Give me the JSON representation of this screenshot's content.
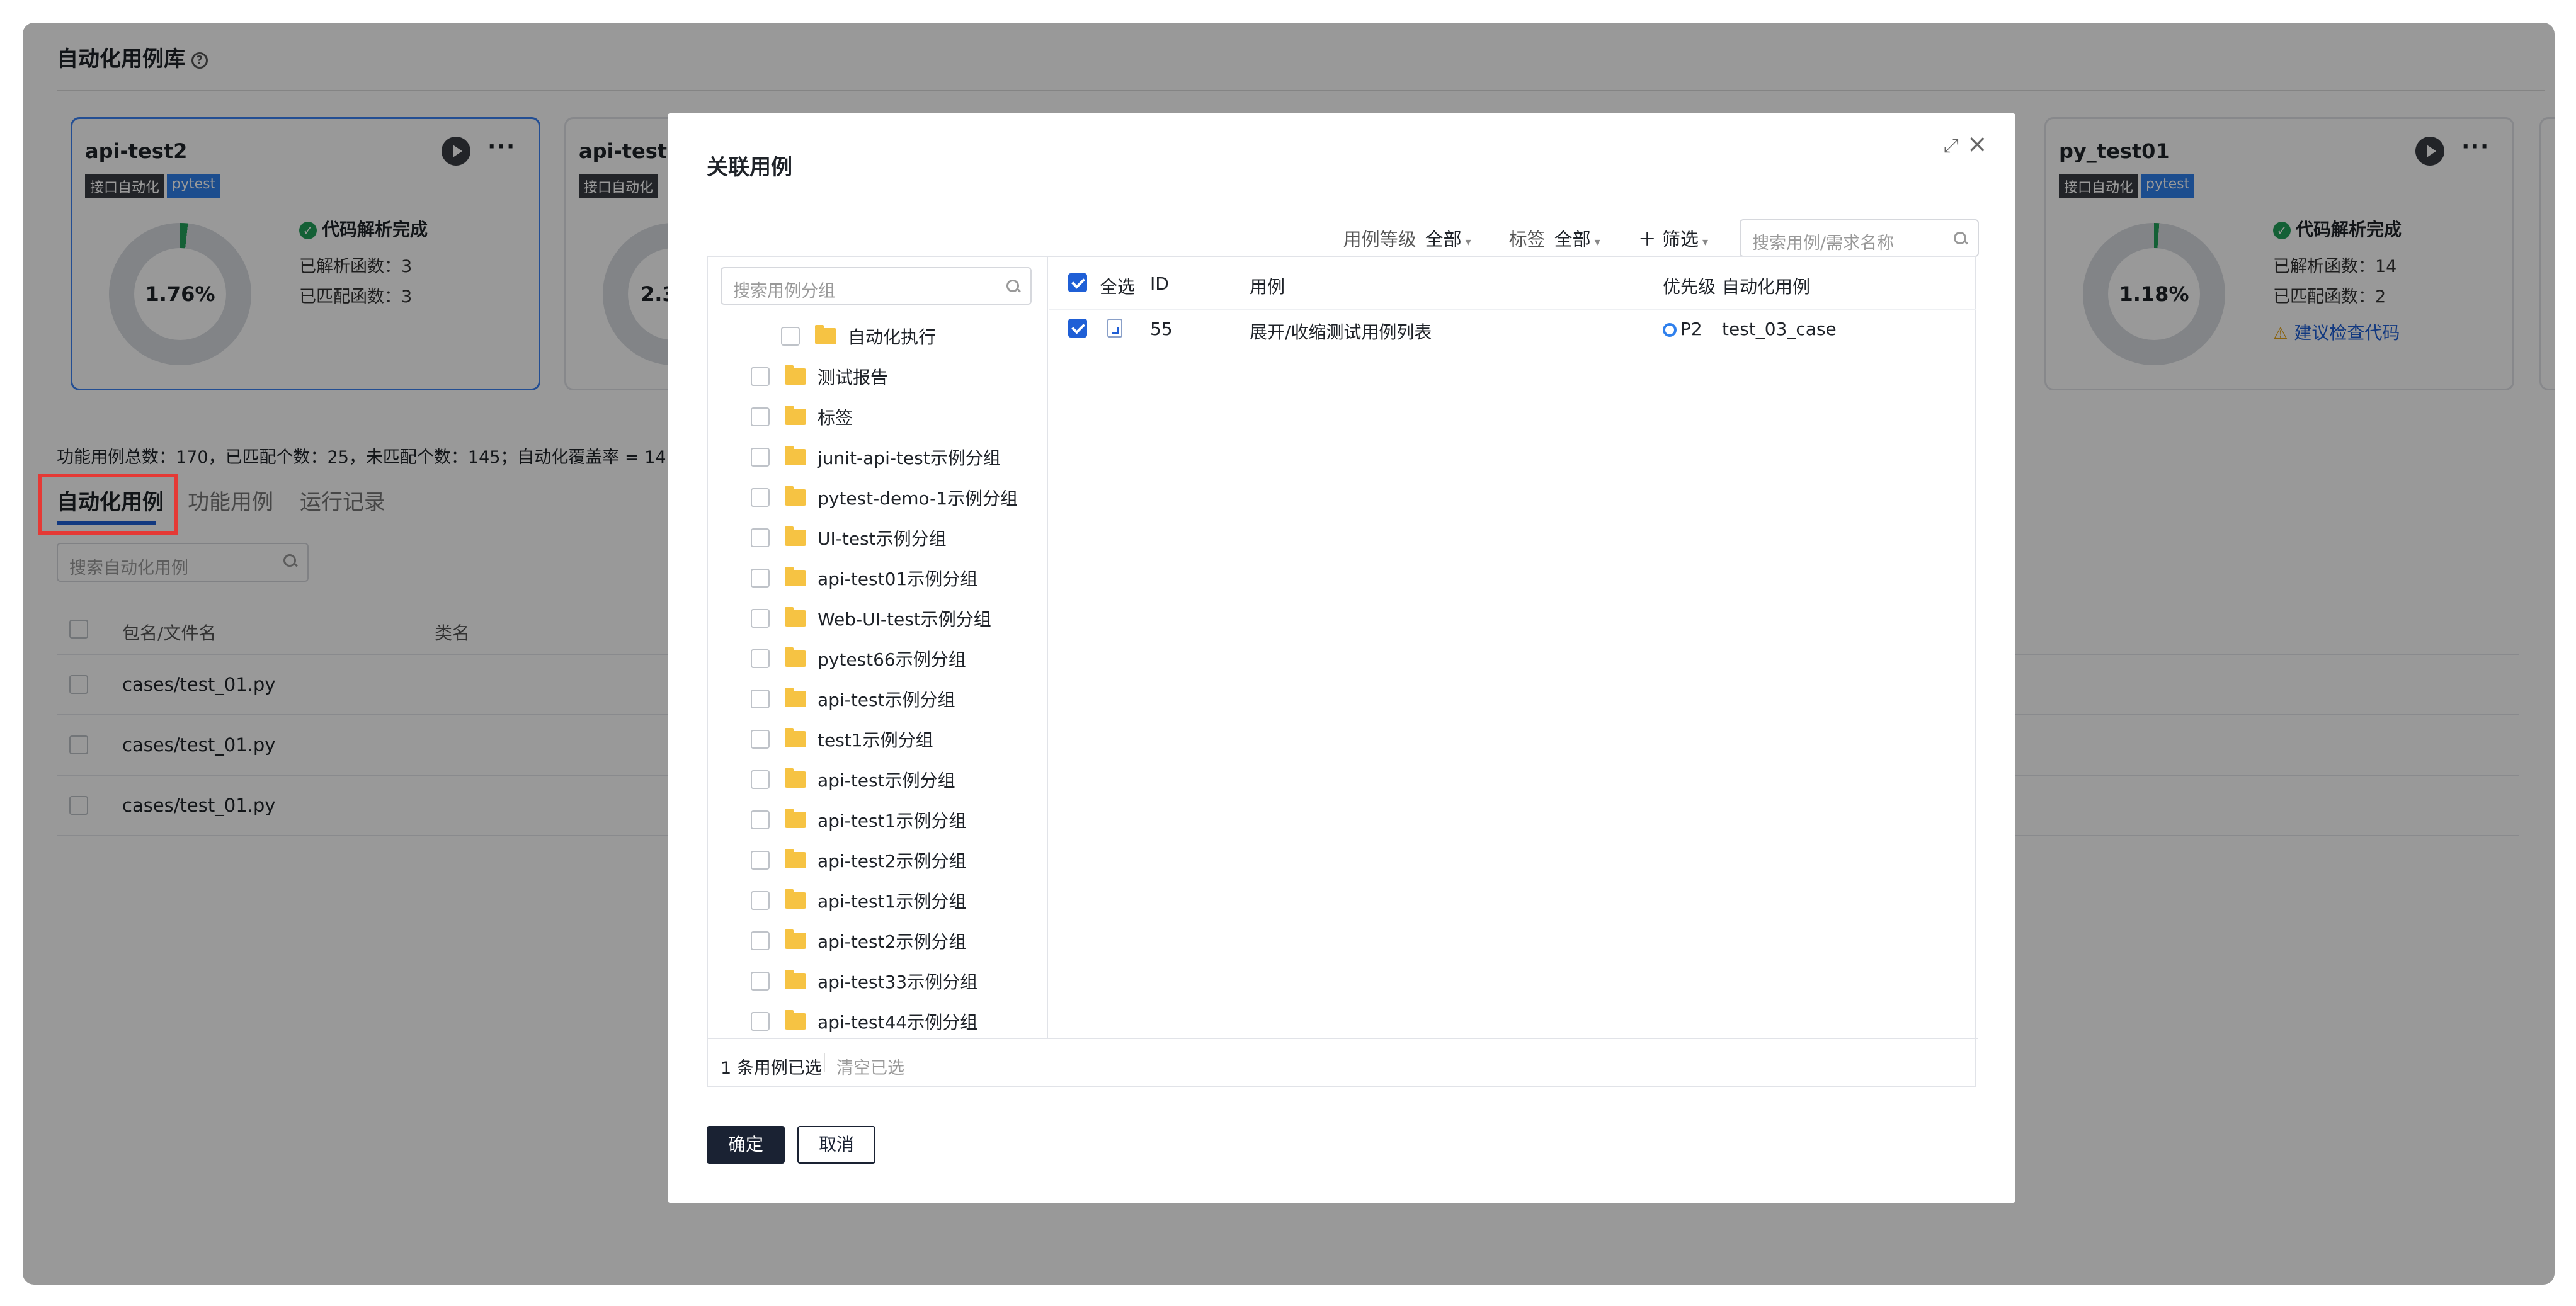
{
  "page": {
    "title": "自动化用例库",
    "summary": "功能用例总数：170，已匹配个数：25，未匹配个数：145；自动化覆盖率 = 14"
  },
  "cards": [
    {
      "name": "api-test2",
      "tags": [
        "接口自动化",
        "pytest"
      ],
      "status": "代码解析完成",
      "parsed": "已解析函数：3",
      "matched": "已匹配函数：3",
      "coverage": "1.76%",
      "coverage_value": 1.76
    },
    {
      "name": "api-test",
      "tags": [
        "接口自动化"
      ],
      "coverage": "2.3",
      "coverage_value": 2.3
    },
    {
      "name": "py_test01",
      "tags": [
        "接口自动化",
        "pytest"
      ],
      "status": "代码解析完成",
      "parsed": "已解析函数：14",
      "matched": "已匹配函数：2",
      "coverage": "1.18%",
      "coverage_value": 1.18,
      "warning": "建议检查代码"
    }
  ],
  "tabs": [
    "自动化用例",
    "功能用例",
    "运行记录"
  ],
  "search_auto": {
    "placeholder": "搜索自动化用例"
  },
  "table": {
    "headers": [
      "包名/文件名",
      "类名"
    ],
    "rows": [
      "cases/test_01.py",
      "cases/test_01.py",
      "cases/test_01.py"
    ]
  },
  "modal": {
    "title": "关联用例",
    "filters": {
      "level_label": "用例等级",
      "level_value": "全部",
      "tag_label": "标签",
      "tag_value": "全部",
      "filter_label": "筛选",
      "search_placeholder": "搜索用例/需求名称"
    },
    "tree_search_placeholder": "搜索用例分组",
    "tree": [
      "自动化执行",
      "测试报告",
      "标签",
      "junit-api-test示例分组",
      "pytest-demo-1示例分组",
      "UI-test示例分组",
      "api-test01示例分组",
      "Web-UI-test示例分组",
      "pytest66示例分组",
      "api-test示例分组",
      "test1示例分组",
      "api-test示例分组",
      "api-test1示例分组",
      "api-test2示例分组",
      "api-test1示例分组",
      "api-test2示例分组",
      "api-test33示例分组",
      "api-test44示例分组"
    ],
    "list_headers": {
      "select_all": "全选",
      "id": "ID",
      "case": "用例",
      "priority": "优先级",
      "auto_case": "自动化用例"
    },
    "list_rows": [
      {
        "id": "55",
        "case": "展开/收缩测试用例列表",
        "priority": "P2",
        "auto_case": "test_03_case"
      }
    ],
    "footer_selected": "1 条用例已选",
    "footer_clear": "清空已选",
    "ok": "确定",
    "cancel": "取消"
  }
}
